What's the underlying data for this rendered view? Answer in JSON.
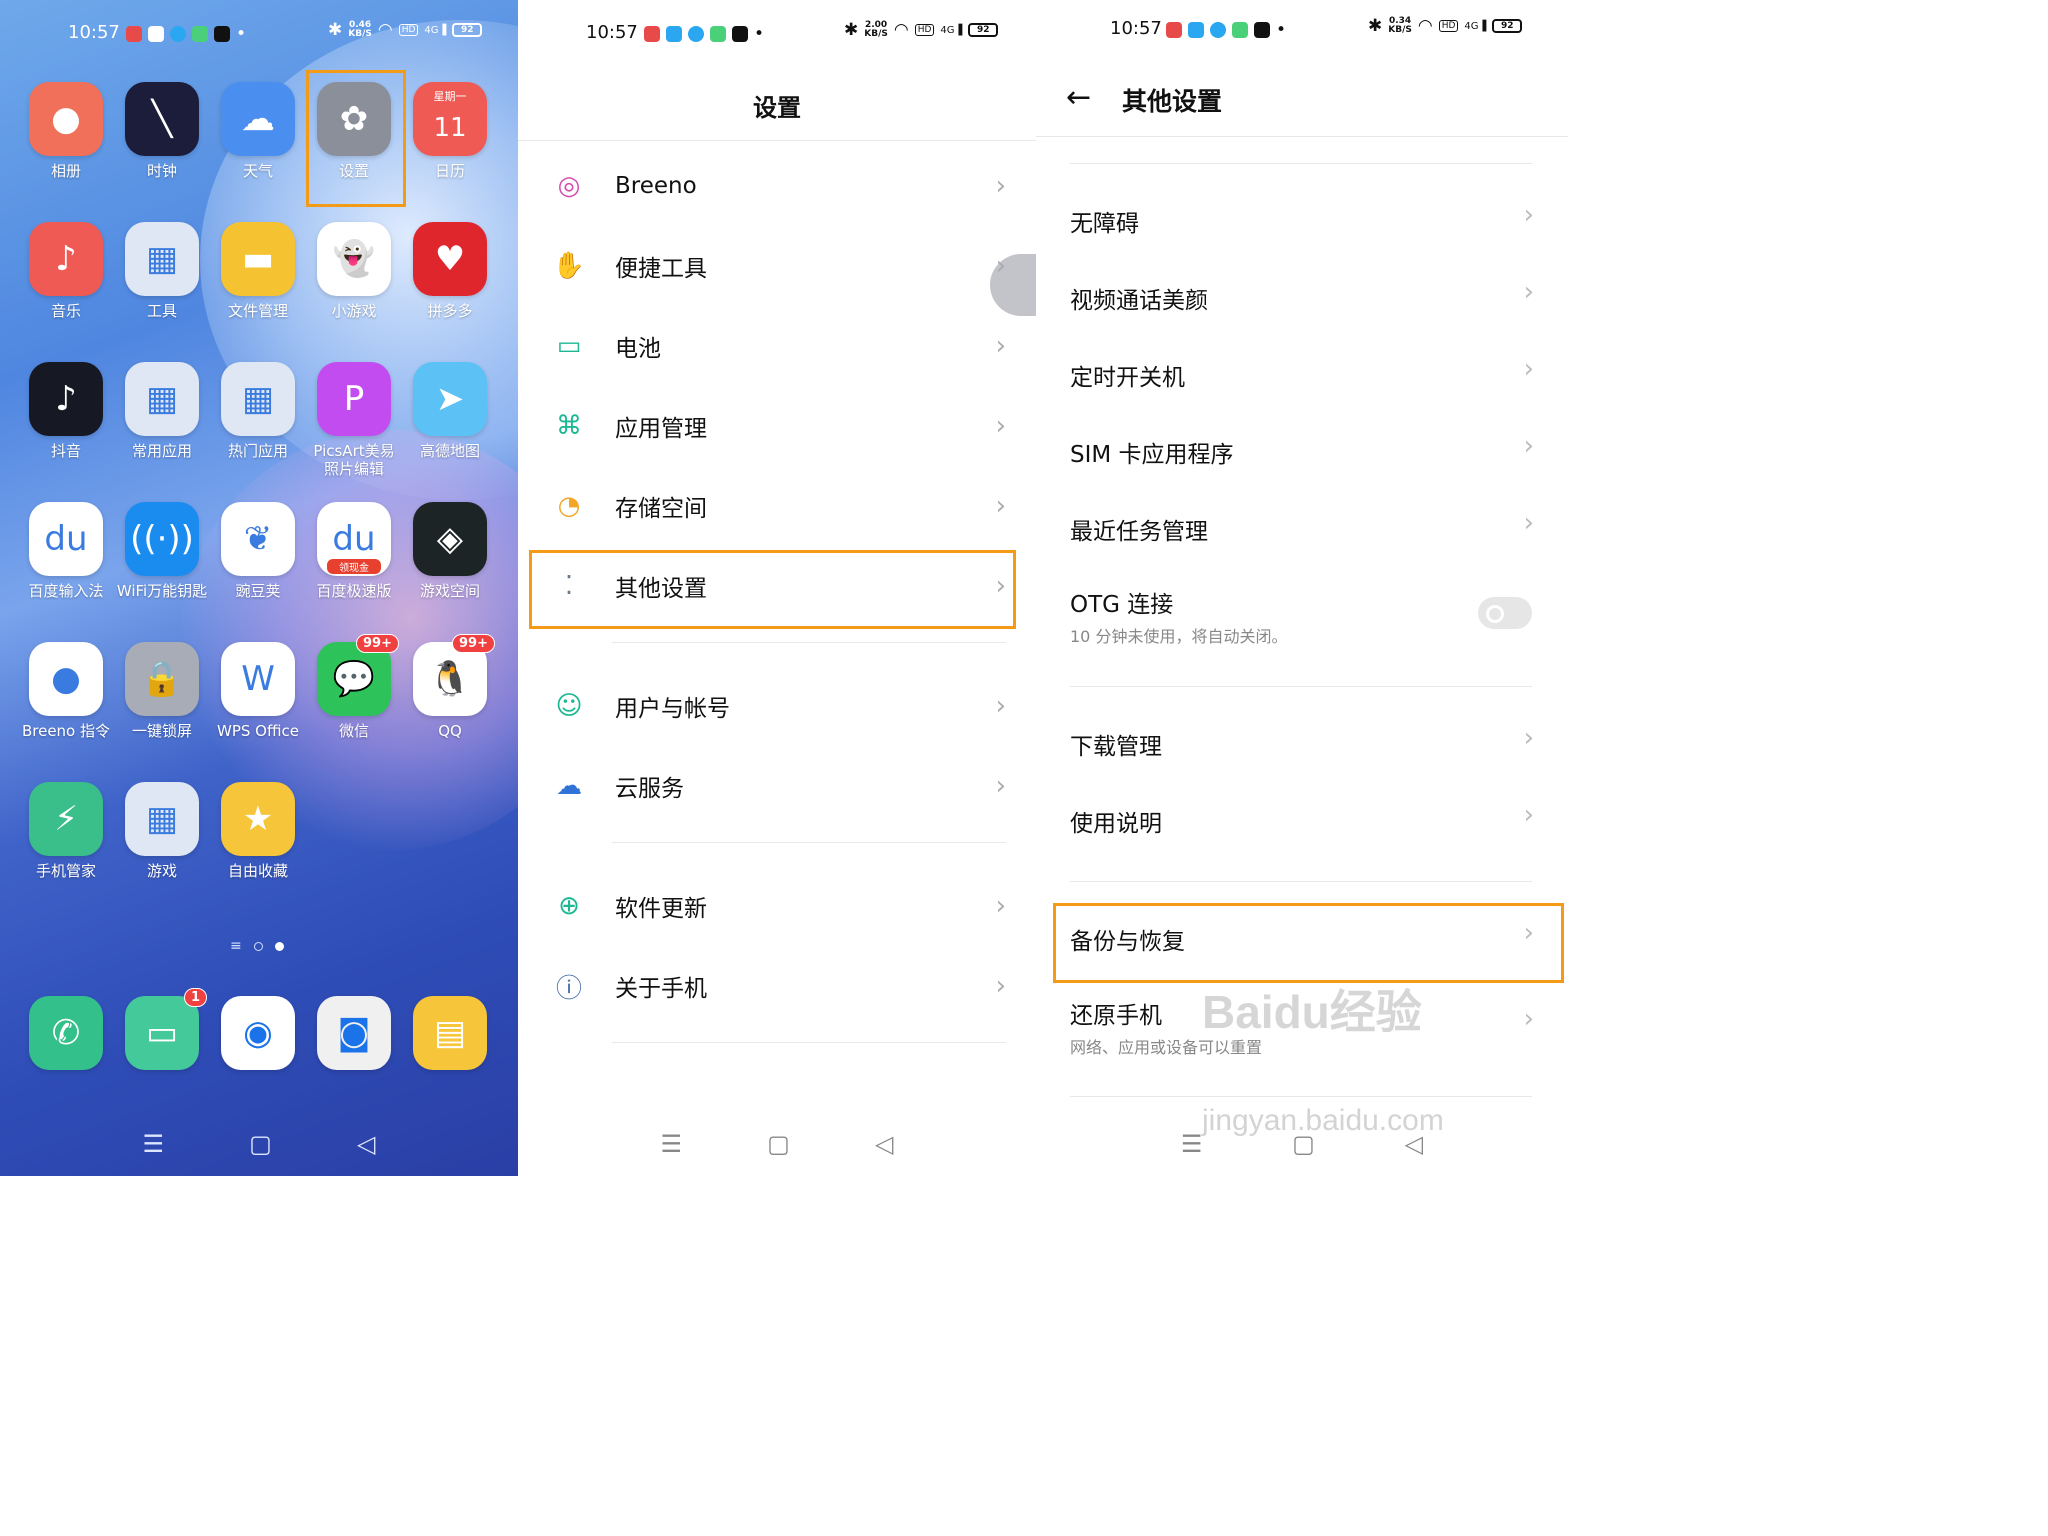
{
  "status_bars": [
    {
      "time": "10:57",
      "speed": "0.46",
      "speed_unit": "KB/S",
      "battery": "92",
      "hd": "HD",
      "net": "4G"
    },
    {
      "time": "10:57",
      "speed": "2.00",
      "speed_unit": "KB/S",
      "battery": "92",
      "hd": "HD",
      "net": "4G"
    },
    {
      "time": "10:57",
      "speed": "0.34",
      "speed_unit": "KB/S",
      "battery": "92",
      "hd": "HD",
      "net": "4G"
    }
  ],
  "home": {
    "apps": [
      {
        "label": "相册",
        "icon": "photos-icon",
        "color": "#f0705a",
        "glyph": "●"
      },
      {
        "label": "时钟",
        "icon": "clock-icon",
        "color": "#1b1d3a",
        "glyph": "╲"
      },
      {
        "label": "天气",
        "icon": "weather-icon",
        "color": "#4a8ff0",
        "glyph": "☁"
      },
      {
        "label": "设置",
        "icon": "settings-icon",
        "color": "#8a8f9a",
        "glyph": "✿"
      },
      {
        "label": "日历",
        "icon": "calendar-icon",
        "color": "#ef5a55",
        "glyph": "11",
        "top": "星期一"
      },
      {
        "label": "音乐",
        "icon": "music-icon",
        "color": "#ef5a55",
        "glyph": "♪"
      },
      {
        "label": "工具",
        "icon": "tools-folder-icon",
        "color": "#dfe7f5",
        "glyph": "▦"
      },
      {
        "label": "文件管理",
        "icon": "files-icon",
        "color": "#f5c232",
        "glyph": "▬"
      },
      {
        "label": "小游戏",
        "icon": "minigame-icon",
        "color": "#ffffff",
        "glyph": "👻"
      },
      {
        "label": "拼多多",
        "icon": "pinduoduo-icon",
        "color": "#e0262d",
        "glyph": "♥"
      },
      {
        "label": "抖音",
        "icon": "douyin-icon",
        "color": "#161823",
        "glyph": "♪"
      },
      {
        "label": "常用应用",
        "icon": "common-apps-folder-icon",
        "color": "#dfe7f5",
        "glyph": "▦"
      },
      {
        "label": "热门应用",
        "icon": "hot-apps-folder-icon",
        "color": "#dfe7f5",
        "glyph": "▦"
      },
      {
        "label": "PicsArt美易照片编辑",
        "icon": "picsart-icon",
        "color": "#c24cf0",
        "glyph": "P"
      },
      {
        "label": "高德地图",
        "icon": "amap-icon",
        "color": "#5cc1f5",
        "glyph": "➤"
      },
      {
        "label": "百度输入法",
        "icon": "baidu-input-icon",
        "color": "#ffffff",
        "glyph": "du"
      },
      {
        "label": "WiFi万能钥匙",
        "icon": "wifi-key-icon",
        "color": "#1a8cf0",
        "glyph": "((·))"
      },
      {
        "label": "豌豆荚",
        "icon": "wandoujia-icon",
        "color": "#ffffff",
        "glyph": "❦"
      },
      {
        "label": "百度极速版",
        "icon": "baidu-lite-icon",
        "color": "#ffffff",
        "glyph": "du",
        "sub": "领现金"
      },
      {
        "label": "游戏空间",
        "icon": "game-space-icon",
        "color": "#1d2426",
        "glyph": "◈"
      },
      {
        "label": "Breeno 指令",
        "icon": "breeno-shortcut-icon",
        "color": "#ffffff",
        "glyph": "●"
      },
      {
        "label": "一键锁屏",
        "icon": "lock-icon",
        "color": "#a8acb6",
        "glyph": "🔒"
      },
      {
        "label": "WPS Office",
        "icon": "wps-icon",
        "color": "#ffffff",
        "glyph": "W"
      },
      {
        "label": "微信",
        "icon": "wechat-icon",
        "color": "#2dc35a",
        "glyph": "💬",
        "badge": "99+"
      },
      {
        "label": "QQ",
        "icon": "qq-icon",
        "color": "#ffffff",
        "glyph": "🐧",
        "badge": "99+"
      },
      {
        "label": "手机管家",
        "icon": "phone-manager-icon",
        "color": "#3bbf8a",
        "glyph": "⚡"
      },
      {
        "label": "游戏",
        "icon": "games-folder-icon",
        "color": "#dfe7f5",
        "glyph": "▦"
      },
      {
        "label": "自由收藏",
        "icon": "collect-icon",
        "color": "#f7c53a",
        "glyph": "★"
      }
    ],
    "dock": [
      {
        "icon": "phone-icon",
        "color": "#34c08a",
        "glyph": "✆"
      },
      {
        "icon": "messages-icon",
        "color": "#44c99a",
        "glyph": "▭",
        "badge": "1"
      },
      {
        "icon": "browser-icon",
        "color": "#ffffff",
        "glyph": "◉"
      },
      {
        "icon": "camera-icon",
        "color": "#f0f0f0",
        "glyph": "◙"
      },
      {
        "icon": "notes-icon",
        "color": "#f7c53a",
        "glyph": "▤"
      }
    ]
  },
  "settings": {
    "title": "设置",
    "items": [
      {
        "label": "Breeno",
        "icon": "breeno-icon",
        "color": "#d64bb0"
      },
      {
        "label": "便捷工具",
        "icon": "convenience-icon",
        "color": "#f08a3a"
      },
      {
        "label": "电池",
        "icon": "battery-icon",
        "color": "#1cb893"
      },
      {
        "label": "应用管理",
        "icon": "app-manage-icon",
        "color": "#1cb893"
      },
      {
        "label": "存储空间",
        "icon": "storage-icon",
        "color": "#f3a524"
      },
      {
        "label": "其他设置",
        "icon": "other-settings-icon",
        "color": "#6a7b8c"
      },
      {
        "label": "用户与帐号",
        "icon": "account-icon",
        "color": "#1cb893"
      },
      {
        "label": "云服务",
        "icon": "cloud-icon",
        "color": "#2f73d6"
      },
      {
        "label": "软件更新",
        "icon": "update-icon",
        "color": "#1cb893"
      },
      {
        "label": "关于手机",
        "icon": "info-icon",
        "color": "#4a6fa5"
      }
    ]
  },
  "other": {
    "title": "其他设置",
    "items": [
      {
        "label": "无障碍"
      },
      {
        "label": "视频通话美颜"
      },
      {
        "label": "定时开关机"
      },
      {
        "label": "SIM 卡应用程序"
      },
      {
        "label": "最近任务管理"
      },
      {
        "label": "OTG 连接",
        "sub": "10 分钟未使用，将自动关闭。",
        "toggle": "off"
      },
      {
        "label": "下载管理"
      },
      {
        "label": "使用说明"
      },
      {
        "label": "备份与恢复"
      },
      {
        "label": "还原手机",
        "sub": "网络、应用或设备可以重置"
      }
    ]
  },
  "watermark": {
    "logo": "Baidu经验",
    "url": "jingyan.baidu.com"
  },
  "highlight_color": "#f39a16"
}
